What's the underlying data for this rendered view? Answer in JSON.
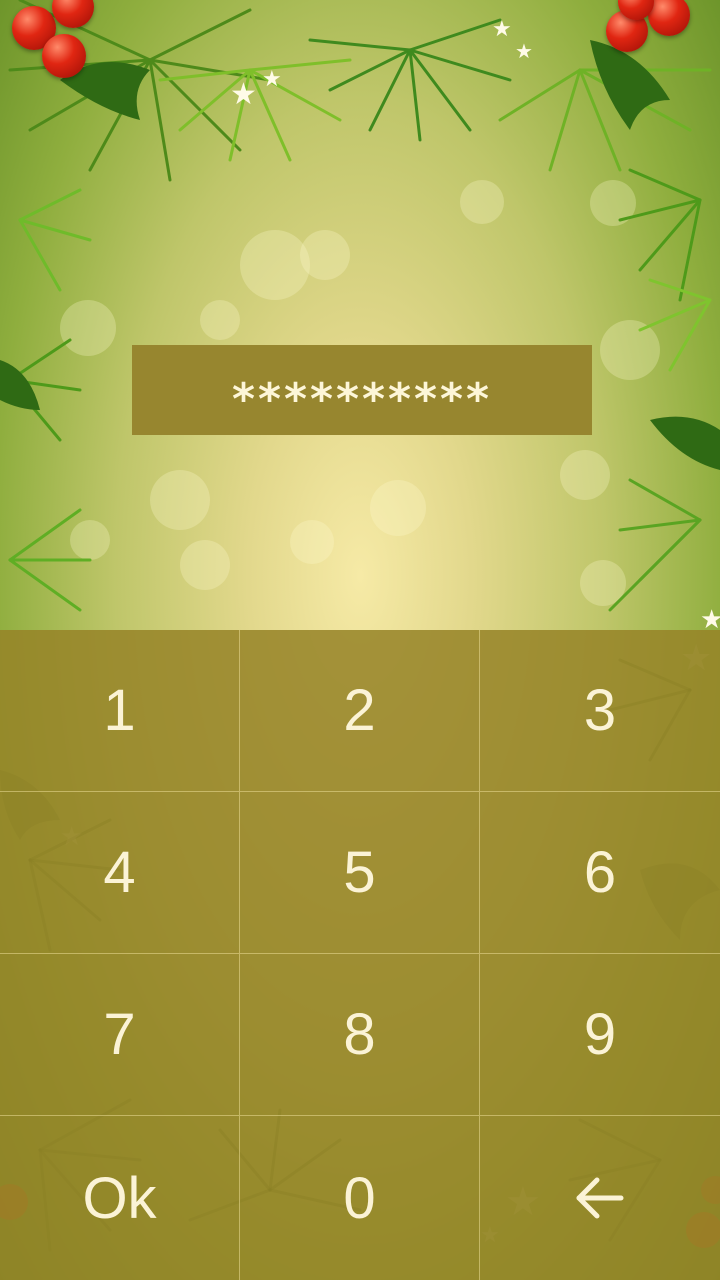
{
  "pin": {
    "masked_value": "**********"
  },
  "keypad": {
    "keys": [
      {
        "label": "1"
      },
      {
        "label": "2"
      },
      {
        "label": "3"
      },
      {
        "label": "4"
      },
      {
        "label": "5"
      },
      {
        "label": "6"
      },
      {
        "label": "7"
      },
      {
        "label": "8"
      },
      {
        "label": "9"
      },
      {
        "label": "Ok"
      },
      {
        "label": "0"
      },
      {
        "icon": "backspace-arrow-icon"
      }
    ]
  },
  "theme": {
    "panel_color": "#97862f",
    "text_color": "#fdf6d8",
    "berry_color": "#e02612"
  }
}
